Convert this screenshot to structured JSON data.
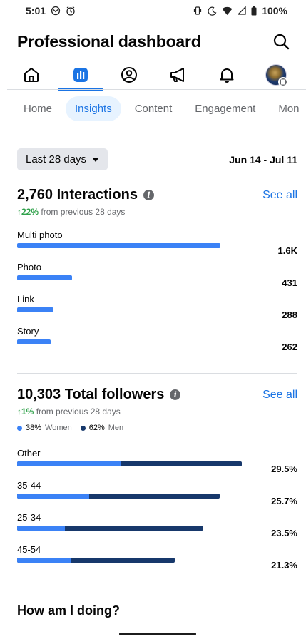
{
  "status_bar": {
    "time": "5:01",
    "battery": "100%"
  },
  "header": {
    "title": "Professional dashboard"
  },
  "tabs": [
    {
      "label": "Home",
      "active": false
    },
    {
      "label": "Insights",
      "active": true
    },
    {
      "label": "Content",
      "active": false
    },
    {
      "label": "Engagement",
      "active": false
    },
    {
      "label": "Mon",
      "active": false
    }
  ],
  "range": {
    "selector": "Last 28 days",
    "dates": "Jun 14 - Jul 11"
  },
  "interactions": {
    "title": "2,760 Interactions",
    "see_all": "See all",
    "change_pct": "↑22%",
    "change_text": "from previous 28 days",
    "bar_color": "#3b82f6",
    "rows": [
      {
        "label": "Multi photo",
        "value": "1.6K",
        "fraction": 0.95
      },
      {
        "label": "Photo",
        "value": "431",
        "fraction": 0.255
      },
      {
        "label": "Link",
        "value": "288",
        "fraction": 0.17
      },
      {
        "label": "Story",
        "value": "262",
        "fraction": 0.155
      }
    ]
  },
  "followers": {
    "title": "10,303 Total followers",
    "see_all": "See all",
    "change_pct": "↑1%",
    "change_text": "from previous 28 days",
    "legend": [
      {
        "pct": "38%",
        "label": "Women",
        "color": "#3b82f6"
      },
      {
        "pct": "62%",
        "label": "Men",
        "color": "#17386b"
      }
    ],
    "rows": [
      {
        "label": "Other",
        "value": "29.5%",
        "women_fraction": 0.46,
        "total_fraction": 1.0
      },
      {
        "label": "35-44",
        "value": "25.7%",
        "women_fraction": 0.355,
        "total_fraction": 0.9
      },
      {
        "label": "25-34",
        "value": "23.5%",
        "women_fraction": 0.255,
        "total_fraction": 0.83
      },
      {
        "label": "45-54",
        "value": "21.3%",
        "women_fraction": 0.34,
        "total_fraction": 0.7
      }
    ]
  },
  "next_section": {
    "title": "How am I doing?"
  }
}
